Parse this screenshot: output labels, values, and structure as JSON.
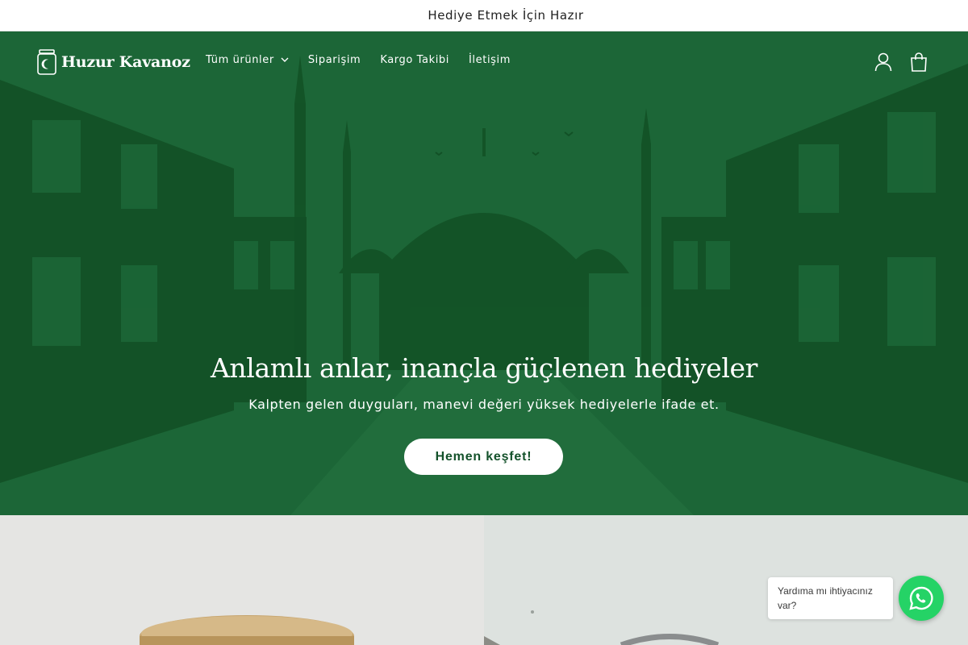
{
  "announcement": {
    "text": "Hediye Etmek İçin Hazır"
  },
  "header": {
    "logo_text": "Huzur Kavanoz",
    "nav": [
      {
        "label": "Tüm ürünler",
        "has_dropdown": true
      },
      {
        "label": "Siparişim"
      },
      {
        "label": "Kargo Takibi"
      },
      {
        "label": "İletişim"
      }
    ],
    "icons": [
      "account-icon",
      "cart-icon"
    ]
  },
  "hero": {
    "title": "Anlamlı anlar, inançla güçlenen hediyeler",
    "subtitle": "Kalpten gelen duyguları, manevi değeri yüksek hediyelerle ifade et.",
    "cta_label": "Hemen keşfet!",
    "background_color": "#1e6b3a",
    "illustration": "street-with-mosque-illustration"
  },
  "chat_widget": {
    "message": "Yardıma mı ihtiyacınız var?",
    "icon": "whatsapp-icon",
    "color": "#25d366"
  }
}
